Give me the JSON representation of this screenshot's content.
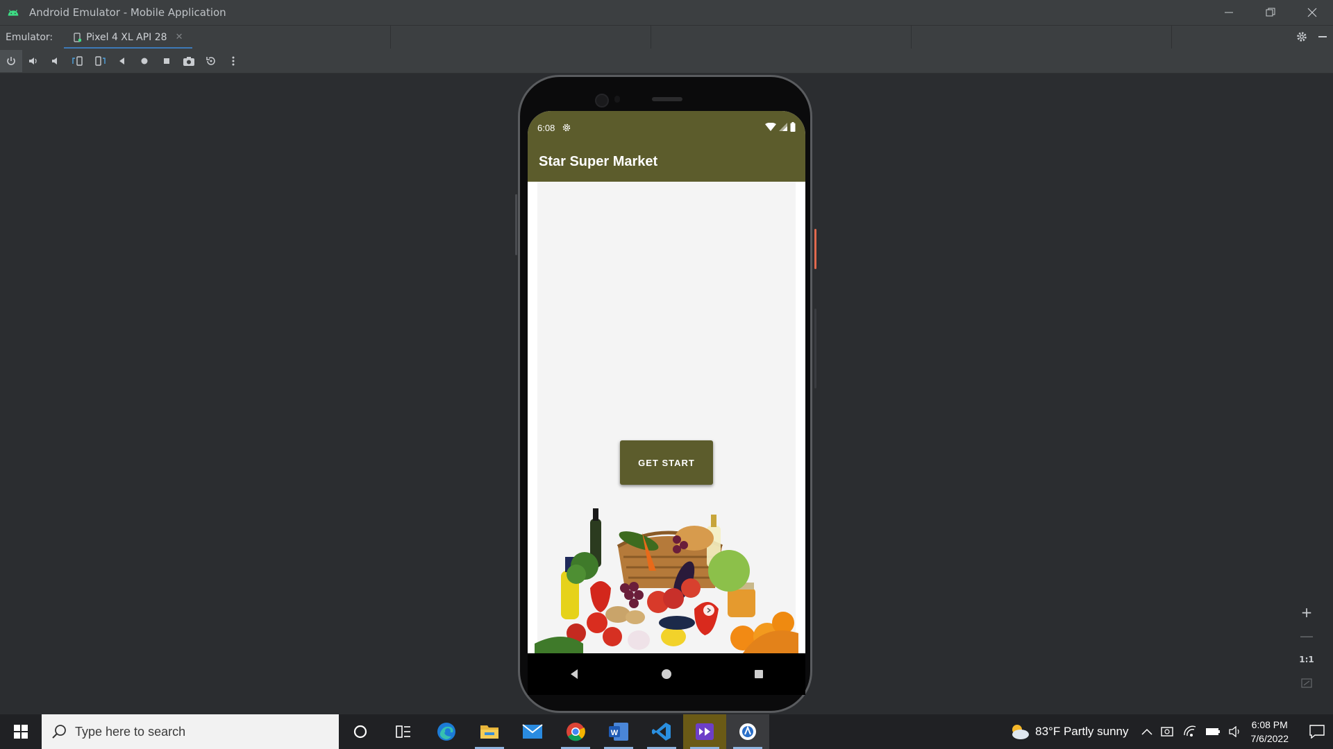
{
  "window": {
    "title": "Android Emulator - Mobile Application",
    "controls": [
      "minimize",
      "restore",
      "close"
    ]
  },
  "tabbar": {
    "label": "Emulator:",
    "device_tab": "Pixel 4 XL API 28",
    "accent_color": "#3d7ab8"
  },
  "toolbar": {
    "tools": [
      "power-icon",
      "volume-up-icon",
      "volume-down-icon",
      "rotate-left-icon",
      "rotate-right-icon",
      "back-icon",
      "home-icon",
      "overview-icon",
      "screenshot-icon",
      "snapshot-icon",
      "more-icon"
    ]
  },
  "phone": {
    "status": {
      "time": "6:08"
    },
    "app_title": "Star Super Market",
    "primary_color": "#5c5c2c",
    "button_label": "GET START",
    "image_label": "grocery basket with fruits, vegetables and bottles"
  },
  "zoom": {
    "zoom_in": "+",
    "zoom_out": "—",
    "one_to_one": "1:1"
  },
  "taskbar": {
    "search_placeholder": "Type here to search",
    "weather": "83°F  Partly sunny",
    "time": "6:08 PM",
    "date": "7/6/2022",
    "apps": [
      "cortana-icon",
      "task-view-icon",
      "edge-icon",
      "file-explorer-icon",
      "mail-icon",
      "chrome-icon",
      "word-icon",
      "vscode-icon",
      "visual-studio-icon",
      "android-studio-icon"
    ]
  }
}
